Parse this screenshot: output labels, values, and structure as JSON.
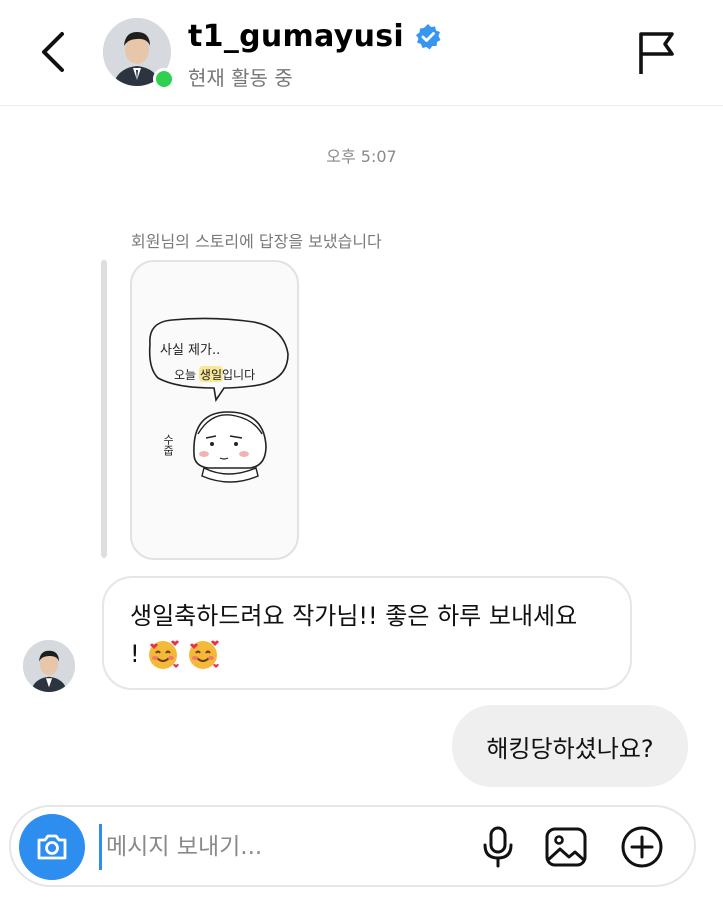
{
  "header": {
    "username": "t1_gumayusi",
    "status": "현재 활동 중",
    "icons": [
      "chevron-left-icon",
      "verified-badge-icon",
      "flag-icon"
    ],
    "colors": {
      "verified": "#3797f0",
      "online": "#2dd14f"
    }
  },
  "chat": {
    "timestamp": "오후 5:07",
    "story_reply_caption": "회원님의 스토리에 답장을 보냈습니다",
    "story": {
      "line1": "사실 제가..",
      "line2_before": "오늘 ",
      "line2_highlight": "생일",
      "line2_after": "입니다",
      "side_text": "수줍"
    },
    "messages": [
      {
        "from": "them",
        "text": "생일축하드려요 작가님!! 좋은 하루 보내세요",
        "text_line2": "!",
        "emoji": "smiling-face-with-hearts"
      },
      {
        "from": "me",
        "text": "해킹당하셨나요?"
      }
    ]
  },
  "composer": {
    "placeholder": "메시지 보내기...",
    "value": "",
    "icons": [
      "camera-icon",
      "microphone-icon",
      "image-icon",
      "add-circle-icon"
    ],
    "accent": "#2d8ef0"
  }
}
